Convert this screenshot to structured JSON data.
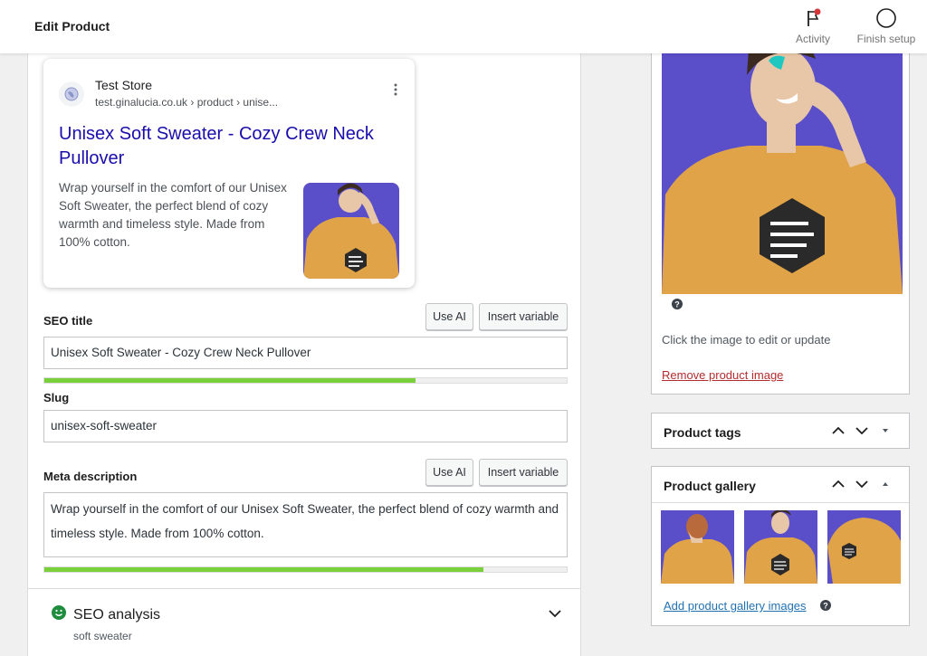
{
  "topbar": {
    "title": "Edit Product",
    "activity_label": "Activity",
    "finish_label": "Finish setup"
  },
  "preview": {
    "store_name": "Test Store",
    "url": "test.ginalucia.co.uk › product › unise...",
    "title": "Unisex Soft Sweater - Cozy Crew Neck Pullover",
    "description": "Wrap yourself in the comfort of our Unisex Soft Sweater, the perfect blend of cozy warmth and timeless style. Made from 100% cotton."
  },
  "seo_title": {
    "label": "SEO title",
    "use_ai": "Use AI",
    "insert_variable": "Insert variable",
    "value": "Unisex Soft Sweater - Cozy Crew Neck Pullover",
    "progress": 0.71
  },
  "slug": {
    "label": "Slug",
    "value": "unisex-soft-sweater"
  },
  "meta_description": {
    "label": "Meta description",
    "use_ai": "Use AI",
    "insert_variable": "Insert variable",
    "value": "Wrap yourself in the comfort of our Unisex Soft Sweater, the perfect blend of cozy warmth and timeless style. Made from 100% cotton.",
    "progress": 0.84
  },
  "seo_analysis": {
    "title": "SEO analysis",
    "keyphrase": "soft sweater"
  },
  "product_image": {
    "hint": "Click the image to edit or update",
    "remove_link": "Remove product image"
  },
  "product_tags": {
    "title": "Product tags"
  },
  "product_gallery": {
    "title": "Product gallery",
    "add_link": "Add product gallery images"
  },
  "colors": {
    "accent_green": "#7ad03a",
    "link_blue": "#2271b1",
    "google_link": "#1a0dab",
    "danger": "#b32d2e",
    "sweater": "#e0a348",
    "photo_bg": "#5a4fc9"
  }
}
